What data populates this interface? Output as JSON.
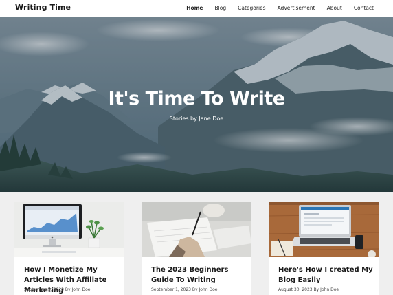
{
  "site": {
    "brand": "Writing Time"
  },
  "nav": {
    "items": [
      {
        "label": "Home",
        "active": true
      },
      {
        "label": "Blog"
      },
      {
        "label": "Categories"
      },
      {
        "label": "Advertisement"
      },
      {
        "label": "About"
      },
      {
        "label": "Contact"
      }
    ]
  },
  "hero": {
    "title": "It's Time To Write",
    "subtitle": "Stories by Jane Doe"
  },
  "posts": [
    {
      "title": "How I Monetize My Articles With Affiliate Marketing",
      "date": "September 3, 2023",
      "by": "By",
      "author": "John Doe"
    },
    {
      "title": "The 2023 Beginners Guide To Writing",
      "date": "September 1, 2023",
      "by": "By",
      "author": "John Doe"
    },
    {
      "title": "Here's How I created My Blog Easily",
      "date": "August 30, 2023",
      "by": "By",
      "author": "John Doe"
    }
  ],
  "colors": {
    "accent": "#1a1a1a",
    "hero_overlay": "#3d5562",
    "page_bg": "#efefef"
  }
}
